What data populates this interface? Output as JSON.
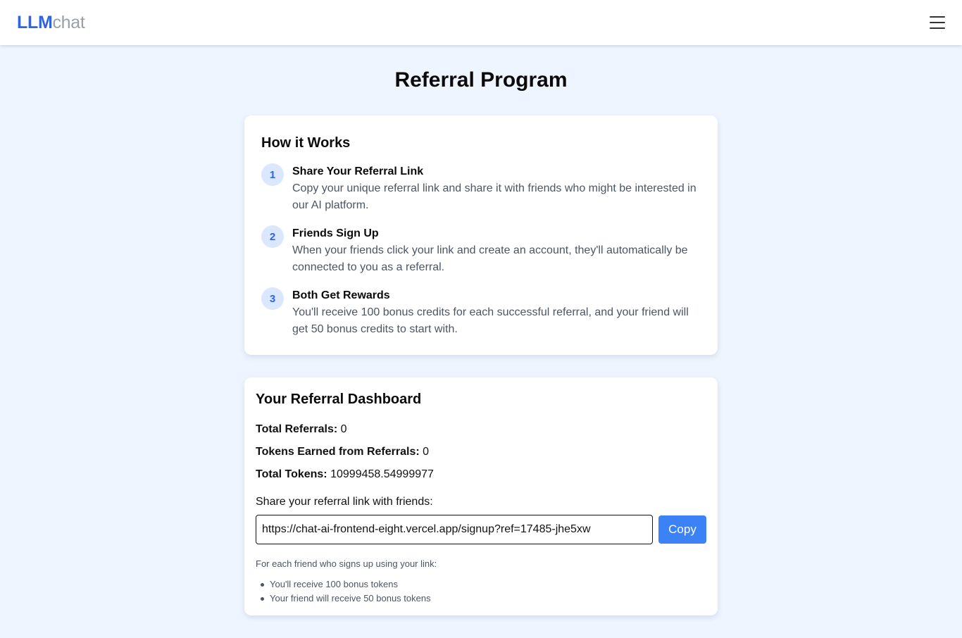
{
  "header": {
    "logo_strong": "LLM",
    "logo_light": "chat",
    "menu_icon": "hamburger-menu-icon"
  },
  "page": {
    "title": "Referral Program"
  },
  "how_it_works": {
    "heading": "How it Works",
    "steps": [
      {
        "number": "1",
        "title": "Share Your Referral Link",
        "description": "Copy your unique referral link and share it with friends who might be interested in our AI platform."
      },
      {
        "number": "2",
        "title": "Friends Sign Up",
        "description": "When your friends click your link and create an account, they'll automatically be connected to you as a referral."
      },
      {
        "number": "3",
        "title": "Both Get Rewards",
        "description": "You'll receive 100 bonus credits for each successful referral, and your friend will get 50 bonus credits to start with."
      }
    ]
  },
  "dashboard": {
    "heading": "Your Referral Dashboard",
    "total_referrals_label": "Total Referrals:",
    "total_referrals_value": "0",
    "tokens_earned_label": "Tokens Earned from Referrals:",
    "tokens_earned_value": "0",
    "total_tokens_label": "Total Tokens:",
    "total_tokens_value": "10999458.54999977",
    "share_label": "Share your referral link with friends:",
    "referral_link": "https://chat-ai-frontend-eight.vercel.app/signup?ref=17485-jhe5xw",
    "copy_label": "Copy",
    "fine_intro": "For each friend who signs up using your link:",
    "fine_items": [
      "You'll receive 100 bonus tokens",
      "Your friend will receive 50 bonus tokens"
    ]
  },
  "colors": {
    "brand": "#2f63e6",
    "background": "#eef5ff",
    "button": "#3b82f6",
    "step_badge": "#dbe7fd"
  }
}
